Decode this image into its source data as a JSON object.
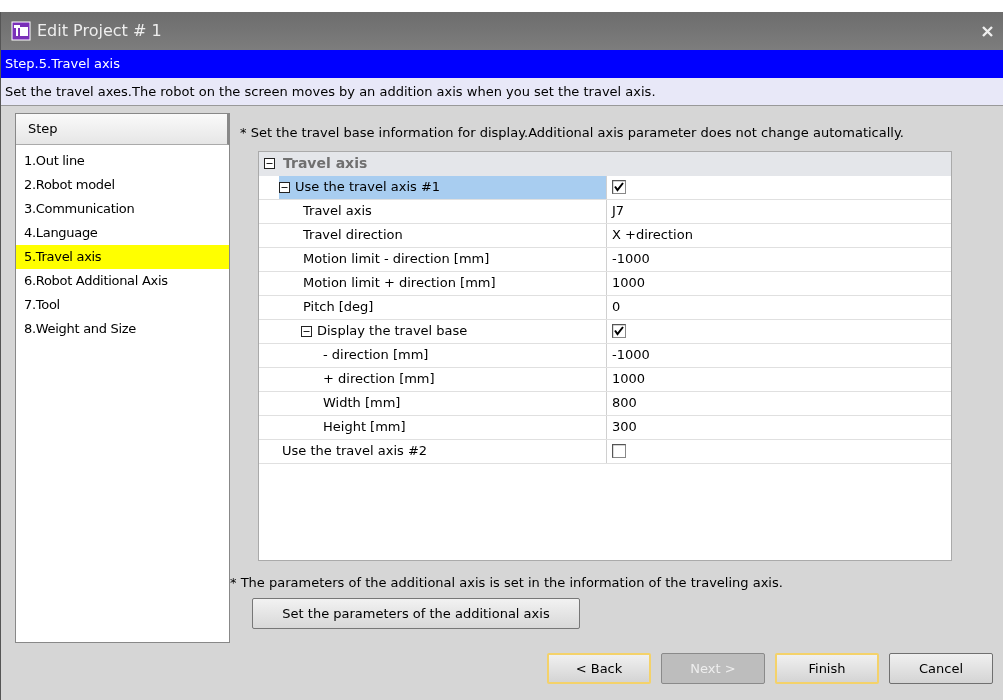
{
  "window": {
    "title": "Edit Project # 1"
  },
  "step_header": "Step.5.Travel axis",
  "step_description": "Set the travel axes.The robot on the screen moves by an addition axis when you set the travel axis.",
  "sidebar": {
    "header": "Step",
    "items": [
      {
        "label": "1.Out line",
        "selected": false
      },
      {
        "label": "2.Robot model",
        "selected": false
      },
      {
        "label": "3.Communication",
        "selected": false
      },
      {
        "label": "4.Language",
        "selected": false
      },
      {
        "label": "5.Travel axis",
        "selected": true
      },
      {
        "label": "6.Robot Additional Axis",
        "selected": false
      },
      {
        "label": "7.Tool",
        "selected": false
      },
      {
        "label": "8.Weight and Size",
        "selected": false
      }
    ]
  },
  "note": "* Set the travel base information for display.Additional axis parameter does not change automatically.",
  "property_grid": {
    "category": {
      "label": "Travel axis",
      "expanded": true
    },
    "rows": [
      {
        "label": "Use the travel axis #1",
        "kind": "checkbox",
        "checked": true,
        "expanded": true,
        "selected": true,
        "children": [
          {
            "label": "Travel axis",
            "kind": "text",
            "value": "J7",
            "selected": false
          },
          {
            "label": "Travel direction",
            "kind": "text",
            "value": "X +direction",
            "selected": false
          },
          {
            "label": "Motion limit  - direction [mm]",
            "kind": "text",
            "value": "-1000",
            "selected": false
          },
          {
            "label": "Motion limit  + direction [mm]",
            "kind": "text",
            "value": "1000",
            "selected": false
          },
          {
            "label": "Pitch [deg]",
            "kind": "text",
            "value": "0",
            "selected": false
          },
          {
            "label": "Display the travel base",
            "kind": "checkbox",
            "checked": true,
            "expanded": true,
            "selected": false,
            "children": [
              {
                "label": "- direction [mm]",
                "kind": "text",
                "value": "-1000",
                "selected": false
              },
              {
                "label": "+ direction [mm]",
                "kind": "text",
                "value": "1000",
                "selected": false
              },
              {
                "label": "Width [mm]",
                "kind": "text",
                "value": "800",
                "selected": false
              },
              {
                "label": "Height [mm]",
                "kind": "text",
                "value": "300",
                "selected": false
              }
            ]
          }
        ]
      },
      {
        "label": "Use the travel axis #2",
        "kind": "checkbox",
        "checked": false,
        "selected": false
      }
    ]
  },
  "footnote": "* The parameters of the additional axis is set in the information of the traveling axis.",
  "param_button": "Set the parameters of the additional axis",
  "buttons": [
    {
      "label": "< Back",
      "disabled": false,
      "focused": true
    },
    {
      "label": "Next >",
      "disabled": true,
      "focused": false
    },
    {
      "label": "Finish",
      "disabled": false,
      "focused": true
    },
    {
      "label": "Cancel",
      "disabled": false,
      "focused": false
    }
  ]
}
